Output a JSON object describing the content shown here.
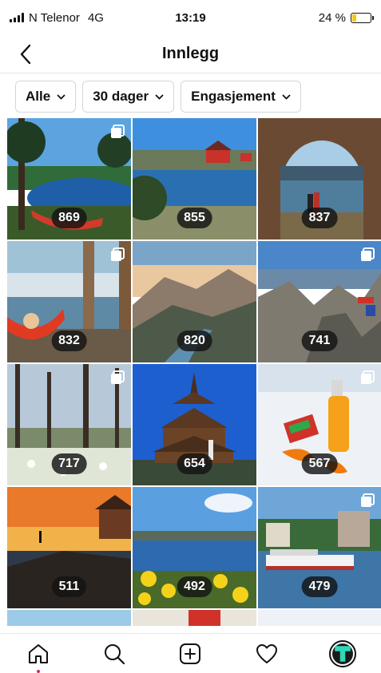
{
  "status_bar": {
    "carrier": "N Telenor",
    "network": "4G",
    "time": "13:19",
    "battery": "24 %",
    "battery_level": 0.24,
    "battery_color": "#f5c518"
  },
  "nav": {
    "title": "Innlegg",
    "back_icon": "chevron-left-icon"
  },
  "filters": [
    {
      "label": "Alle"
    },
    {
      "label": "30 dager"
    },
    {
      "label": "Engasjement"
    }
  ],
  "posts": [
    {
      "count": "869",
      "multi": true,
      "scene": "lake-forest-hammock"
    },
    {
      "count": "855",
      "multi": false,
      "scene": "coastal-red-cabin"
    },
    {
      "count": "837",
      "multi": false,
      "scene": "cave-fjord-view"
    },
    {
      "count": "832",
      "multi": true,
      "scene": "hammock-porch-lake"
    },
    {
      "count": "820",
      "multi": false,
      "scene": "mountain-valley"
    },
    {
      "count": "741",
      "multi": true,
      "scene": "rocky-cliffs"
    },
    {
      "count": "717",
      "multi": true,
      "scene": "spring-forest"
    },
    {
      "count": "654",
      "multi": false,
      "scene": "stave-church"
    },
    {
      "count": "567",
      "multi": true,
      "scene": "snow-orange-kvikk-lunsj"
    },
    {
      "count": "511",
      "multi": false,
      "scene": "sunset-cabin"
    },
    {
      "count": "492",
      "multi": false,
      "scene": "yellow-flowers-coast"
    },
    {
      "count": "479",
      "multi": true,
      "scene": "harbor-town"
    }
  ],
  "tab_bar": {
    "items": [
      "home-icon",
      "search-icon",
      "add-post-icon",
      "heart-icon",
      "profile-avatar"
    ],
    "accent": "#e0245e"
  }
}
